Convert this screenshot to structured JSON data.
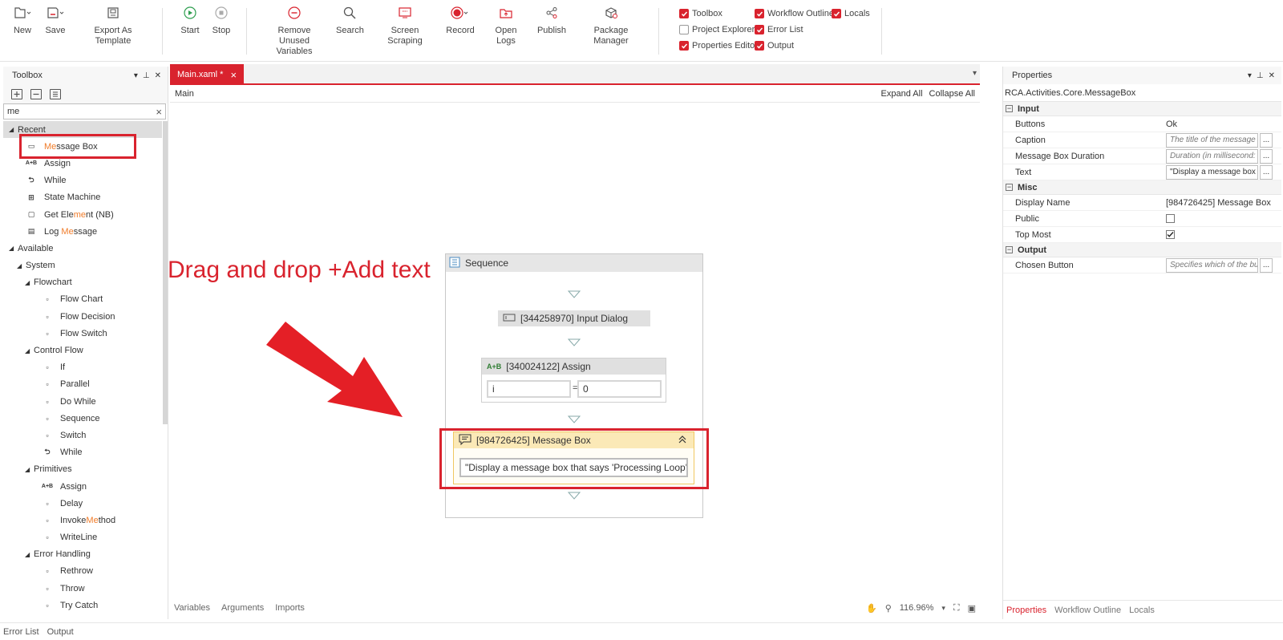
{
  "ribbon": {
    "new": "New",
    "save": "Save",
    "export": "Export As Template",
    "start": "Start",
    "stop": "Stop",
    "remove_unused_1": "Remove Unused",
    "remove_unused_2": "Variables",
    "search": "Search",
    "screen_scraping": "Screen Scraping",
    "record": "Record",
    "open_logs": "Open Logs",
    "publish": "Publish",
    "package_manager": "Package Manager",
    "checks": {
      "toolbox": "Toolbox",
      "workflow_outline": "Workflow Outline",
      "locals": "Locals",
      "project_explorer": "Project Explorer",
      "error_list": "Error List",
      "properties_editor": "Properties Editor",
      "output": "Output"
    }
  },
  "toolbox": {
    "title": "Toolbox",
    "search_value": "me",
    "clear": "×",
    "recent": "Recent",
    "recent_items": [
      {
        "pre": "",
        "hl": "Me",
        "post": "ssage Box",
        "icon": "message-box-icon"
      },
      {
        "pre": "Assign",
        "hl": "",
        "post": "",
        "icon": "assign-icon"
      },
      {
        "pre": "While",
        "hl": "",
        "post": "",
        "icon": "while-icon"
      },
      {
        "pre": "State Machine",
        "hl": "",
        "post": "",
        "icon": "state-machine-icon"
      },
      {
        "pre": "Get Ele",
        "hl": "me",
        "post": "nt (NB)",
        "icon": "get-element-icon"
      },
      {
        "pre": "Log ",
        "hl": "Me",
        "post": "ssage",
        "icon": "log-message-icon"
      }
    ],
    "available": "Available",
    "system": "System",
    "flowchart": "Flowchart",
    "flowchart_items": [
      "Flow Chart",
      "Flow Decision",
      "Flow Switch"
    ],
    "control_flow": "Control Flow",
    "control_flow_items": [
      "If",
      "Parallel",
      "Do While",
      "Sequence",
      "Switch",
      "While"
    ],
    "primitives": "Primitives",
    "primitives_items": [
      {
        "pre": "Assign",
        "hl": "",
        "post": ""
      },
      {
        "pre": "Delay",
        "hl": "",
        "post": ""
      },
      {
        "pre": "Invoke",
        "hl": "Me",
        "post": "thod"
      },
      {
        "pre": "WriteLine",
        "hl": "",
        "post": ""
      }
    ],
    "error_handling": "Error Handling",
    "error_handling_items": [
      "Rethrow",
      "Throw",
      "Try Catch"
    ]
  },
  "designer": {
    "tab_label": "Main.xaml *",
    "tab_close": "×",
    "breadcrumb": "Main",
    "expand_all": "Expand All",
    "collapse_all": "Collapse All",
    "sequence_title": "Sequence",
    "input_dialog": "[344258970] Input Dialog",
    "assign_title": "[340024122] Assign",
    "assign_left": "i",
    "assign_eq": "=",
    "assign_right": "0",
    "message_box_title": "[984726425] Message Box",
    "message_box_text": "\"Display a message box that says 'Processing Loop' for",
    "bottom_tabs": [
      "Variables",
      "Arguments",
      "Imports"
    ],
    "zoom": "116.96%"
  },
  "annotation": {
    "text": "Drag and drop +Add text"
  },
  "properties": {
    "title": "Properties",
    "type": "RCA.Activities.Core.MessageBox",
    "cat_input": "Input",
    "cat_misc": "Misc",
    "cat_output": "Output",
    "buttons_label": "Buttons",
    "buttons_value": "Ok",
    "caption_label": "Caption",
    "caption_placeholder": "The title of the message",
    "duration_label": "Message Box Duration",
    "duration_placeholder": "Duration (in millisecond:",
    "text_label": "Text",
    "text_value": "\"Display a message box",
    "display_name_label": "Display Name",
    "display_name_value": "[984726425] Message Box",
    "public_label": "Public",
    "public_checked": false,
    "top_most_label": "Top Most",
    "top_most_checked": true,
    "chosen_label": "Chosen Button",
    "chosen_placeholder": "Specifies which of the bu",
    "dots": "...",
    "tabs": [
      "Properties",
      "Workflow Outline",
      "Locals"
    ]
  },
  "status": {
    "error_list": "Error List",
    "output": "Output"
  },
  "colors": {
    "accent": "#d9232e",
    "highlight_text": "#f07c2a",
    "activity_selected": "#fbe9b7"
  }
}
